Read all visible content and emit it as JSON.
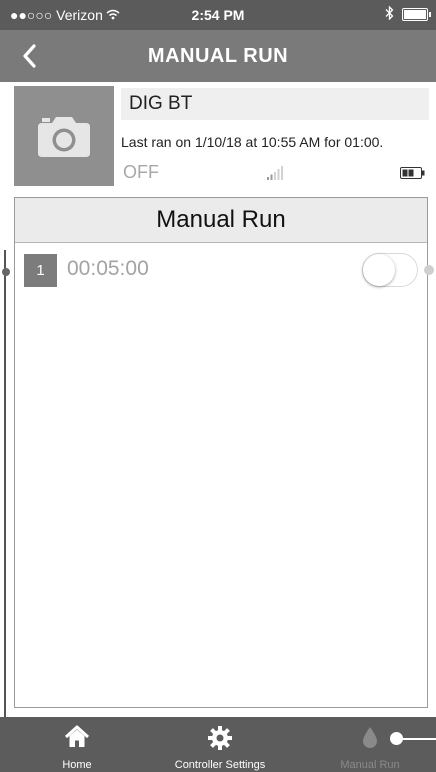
{
  "status_bar": {
    "carrier": "●●○○○ Verizon",
    "time": "2:54 PM"
  },
  "nav": {
    "title": "MANUAL RUN"
  },
  "controller": {
    "name": "DIG BT",
    "last_ran": "Last ran on 1/10/18 at 10:55 AM for 01:00.",
    "state": "OFF",
    "battery_level": 0.6,
    "signal_bars": 2
  },
  "manual_run": {
    "header": "Manual Run",
    "zones": [
      {
        "number": "1",
        "duration": "00:05:00",
        "enabled": false
      }
    ]
  },
  "tabs": {
    "home": "Home",
    "settings": "Controller Settings",
    "manual_run": "Manual Run"
  },
  "colors": {
    "status_bar": "#5b5b5b",
    "nav_bar": "#7a7a7a",
    "tab_bar": "#5c5c5c"
  }
}
